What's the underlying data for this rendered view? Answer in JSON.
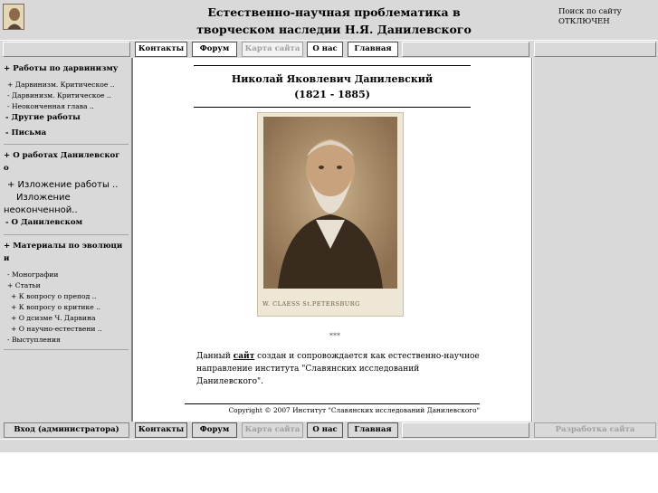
{
  "header": {
    "title_line1": "Естественно-научная проблематика в",
    "title_line2": "творческом наследии Н.Я. Данилевского",
    "search_label": "Поиск по сайту",
    "search_status": "ОТКЛЮЧЕН"
  },
  "topnav": {
    "contacts": "Контакты",
    "forum": "Форум",
    "sitemap": "Карта сайта",
    "about": "О нас",
    "home": "Главная"
  },
  "bottomnav": {
    "admin_login": "Вход (администратора)",
    "contacts": "Контакты",
    "forum": "Форум",
    "sitemap": "Карта сайта",
    "about": "О нас",
    "home": "Главная",
    "development": "Разработка сайта"
  },
  "sidebar": {
    "s1_title": "+ Работы по дарвинизму",
    "s1_items": [
      "+ Дарвинизм. Критическое ..",
      "-  Дарвинизм. Критическое ..",
      "-  Неоконченная глава .."
    ],
    "s1_other": "- Другие работы",
    "s1_letters": "- Письма",
    "s2_title_a": "+ О работах Данилевског",
    "s2_title_b": "о",
    "s2_items": [
      "+ Изложение работы ..",
      "Изложение",
      "неоконченной.."
    ],
    "s2_about": "- О Данилевском",
    "s3_title_a": "+ Материалы по эволюци",
    "s3_title_b": "и",
    "s3_items": [
      "-  Монографии",
      "+ Статьи"
    ],
    "s3_articles": [
      "+ К вопросу о препод ..",
      "+ К вопросу о критике ..",
      "+ О дсизме Ч. Дарвина",
      "+ О научно-естествени .."
    ],
    "s3_speeches": "-  Выступления"
  },
  "main": {
    "name": "Николай Яковлевич Данилевский",
    "years": "(1821 - 1885)",
    "stars": "***",
    "about_prefix": "Данный",
    "about_link": "сайт",
    "about_rest1": " создан и сопровождается как естественно-научное",
    "about_line2": "направление института \"Славянских исследований Данилевского\".",
    "copyright": "Copyright © 2007 Институт \"Славянских исследований Данилевского\"",
    "photo_caption": "W. CLAESS    St.PETERSBURG"
  }
}
